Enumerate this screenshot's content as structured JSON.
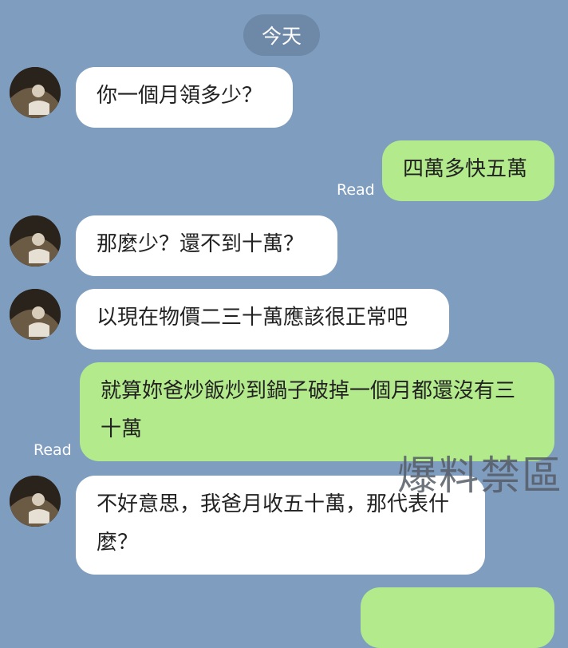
{
  "date_label": "今天",
  "messages": [
    {
      "text": "你一個月領多少？"
    },
    {
      "text": "四萬多快五萬",
      "status": "Read"
    },
    {
      "text": "那麼少？還不到十萬？"
    },
    {
      "text": "以現在物價二三十萬應該很正常吧"
    },
    {
      "text": "就算妳爸炒飯炒到鍋子破掉一個月都還沒有三十萬",
      "status": "Read"
    },
    {
      "text": "不好意思，我爸月收五十萬，那代表什麼？"
    },
    {
      "text": "..."
    }
  ],
  "watermark": "爆料禁區",
  "colors": {
    "background": "#7f9dbf",
    "incoming": "#ffffff",
    "outgoing": "#b2ea8c",
    "date_pill": "#6e88a8"
  }
}
